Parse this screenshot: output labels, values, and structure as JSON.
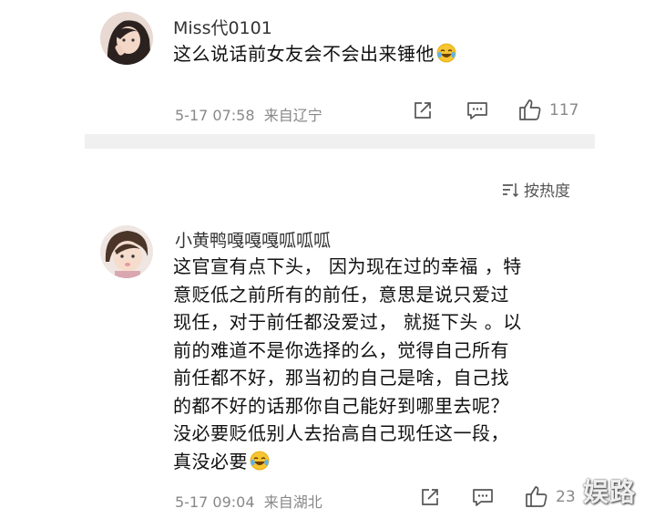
{
  "comments": [
    {
      "username": "Miss代0101",
      "text_parts": [
        "这么说话前女友会不会出来锤他"
      ],
      "time": "5-17 07:58",
      "location": "来自辽宁",
      "likes": "117",
      "emoji": "laugh-cry-emoji"
    },
    {
      "username": "小黄鸭嘎嘎嘎呱呱呱",
      "text_lines": [
        "这官宣有点下头， 因为现在过的幸福 ，特",
        "意贬低之前所有的前任，意思是说只爱过",
        "现任，对于前任都没爱过， 就挺下头 。以",
        "前的难道不是你选择的么，觉得自己所有",
        "前任都不好，那当初的自己是啥，自己找",
        "的都不好的话那你自己能好到哪里去呢？",
        "没必要贬低别人去抬高自己现任这一段，",
        "真没必要"
      ],
      "time": "5-17 09:04",
      "location": "来自湖北",
      "likes": "23",
      "emoji": "laugh-cry-emoji"
    }
  ],
  "sort": {
    "label": "按热度",
    "icon": "sort-icon"
  },
  "watermark": "娱路",
  "colors": {
    "divider": "#f0f0f0",
    "meta": "#888888",
    "text": "#111111"
  }
}
